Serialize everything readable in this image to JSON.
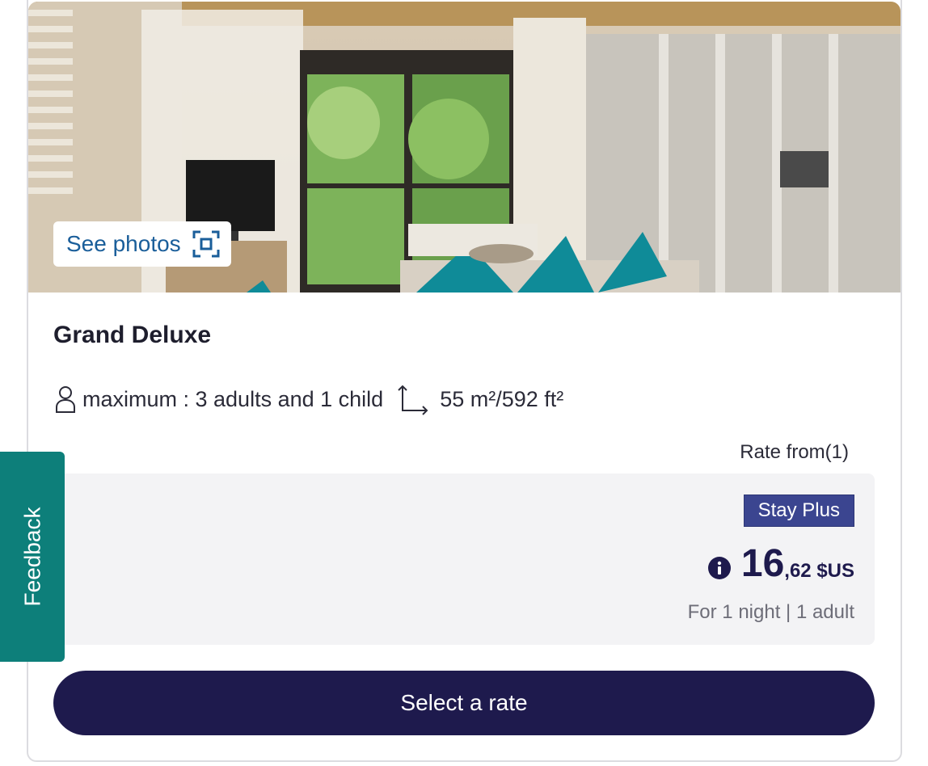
{
  "room": {
    "name": "Grand Deluxe",
    "see_photos_label": "See photos",
    "capacity_text": "maximum : 3 adults and 1 child",
    "size_text": "55 m²/592 ft²"
  },
  "rate": {
    "rate_from_label": "Rate from(1)",
    "badge": "Stay Plus",
    "price_main": "16",
    "price_cents": ",62 $US",
    "price_note": "For 1 night | 1 adult"
  },
  "actions": {
    "select_label": "Select a rate"
  },
  "feedback": {
    "label": "Feedback"
  },
  "colors": {
    "brand_navy": "#1e1a4d",
    "badge_blue": "#3b4590",
    "feedback_teal": "#0d7f7a",
    "link_blue": "#1a5e9a"
  },
  "icons": {
    "photos": "expand-frame-icon",
    "capacity": "person-icon",
    "size": "area-arrows-icon",
    "info": "info-icon"
  }
}
